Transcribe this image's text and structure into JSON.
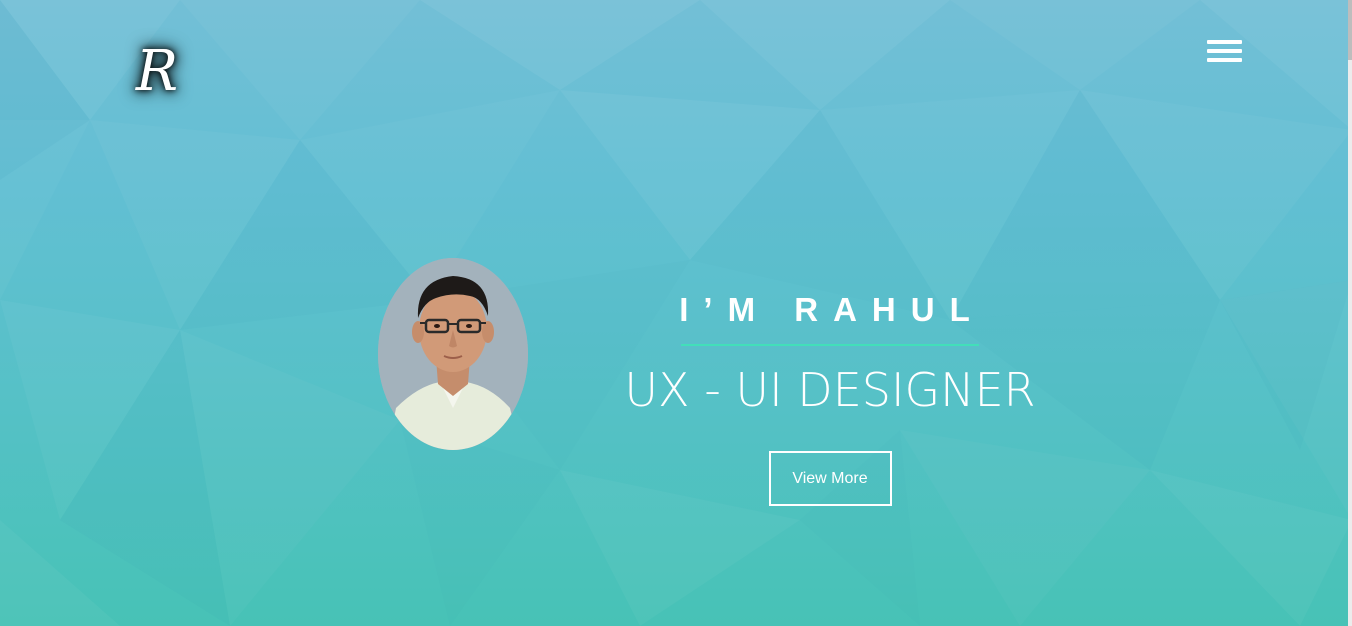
{
  "header": {
    "logo_letter": "R",
    "menu_icon": "hamburger-menu-icon"
  },
  "hero": {
    "avatar_icon": "profile-photo",
    "greeting": "I’M RAHUL",
    "role": "UX - UI DESIGNER",
    "cta_label": "View More"
  },
  "colors": {
    "background_top": "#73bfd6",
    "background_bottom": "#47c2b6",
    "divider": "#42dfb9",
    "text": "#ffffff"
  }
}
